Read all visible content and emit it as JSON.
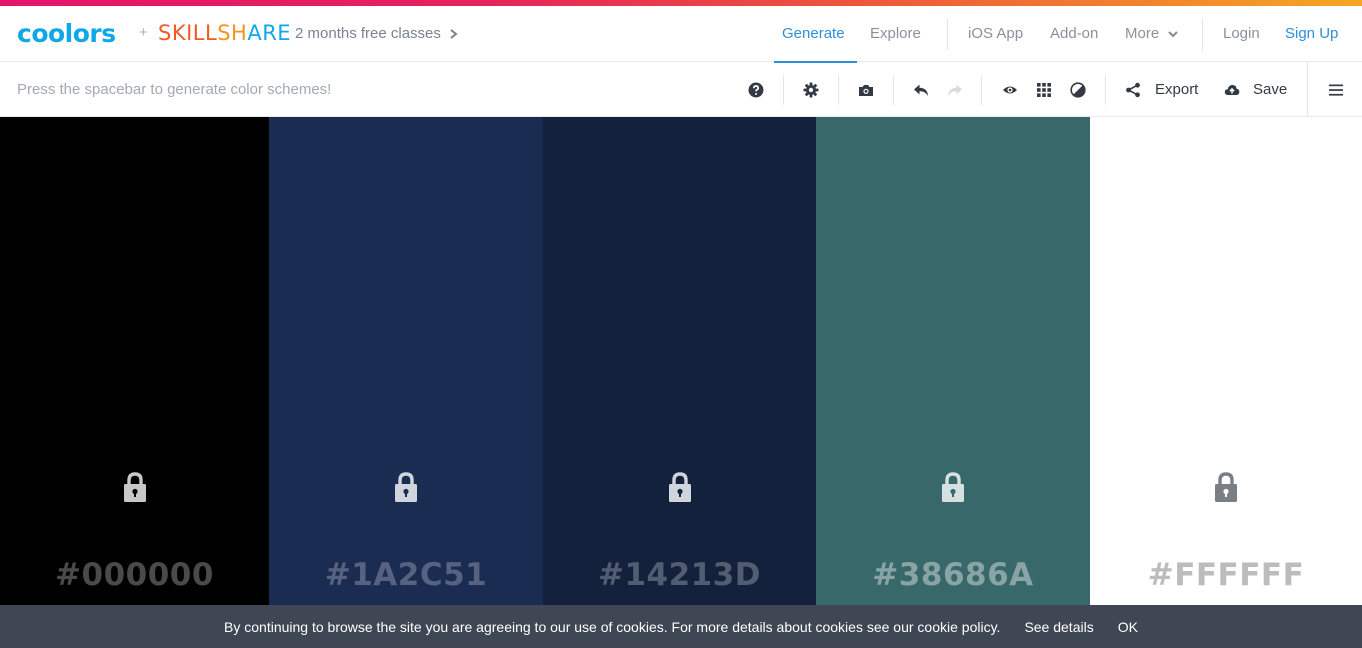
{
  "colors": {
    "brand_blue": "#0fa7e8",
    "accent": "#2f8fd8",
    "skillshare": [
      "#f15a24",
      "#f7931e",
      "#0fa7e8"
    ]
  },
  "header": {
    "logo": "coolors",
    "plus": "+",
    "partner": "SKILLSHARE",
    "promo": "2 months free classes",
    "nav": {
      "generate": "Generate",
      "explore": "Explore",
      "ios_app": "iOS App",
      "addon": "Add-on",
      "more": "More",
      "login": "Login",
      "signup": "Sign Up"
    }
  },
  "toolbar": {
    "hint": "Press the spacebar to generate color schemes!",
    "icons": [
      "help-icon",
      "settings-icon",
      "camera-icon",
      "undo-icon",
      "redo-icon",
      "eye-icon",
      "grid-icon",
      "contrast-icon",
      "share-icon",
      "cloud-upload-icon",
      "menu-icon"
    ],
    "export": "Export",
    "save": "Save"
  },
  "palette": [
    {
      "hex": "#000000",
      "bg": "#000000",
      "text_color": "#4a4a4a",
      "lock_color": "#c8c8c8"
    },
    {
      "hex": "#1A2C51",
      "bg": "#1a2c51",
      "text_color": "#56627f",
      "lock_color": "#d0d4dc"
    },
    {
      "hex": "#14213D",
      "bg": "#14213d",
      "text_color": "#535d72",
      "lock_color": "#d0d4dc"
    },
    {
      "hex": "#38686A",
      "bg": "#38686a",
      "text_color": "#88a4a5",
      "lock_color": "#d6e0e0"
    },
    {
      "hex": "#FFFFFF",
      "bg": "#ffffff",
      "text_color": "#bcbcbc",
      "lock_color": "#7a7f87"
    }
  ],
  "cookie": {
    "message": "By continuing to browse the site you are agreeing to our use of cookies. For more details about cookies see our cookie policy.",
    "details": "See details",
    "ok": "OK"
  }
}
